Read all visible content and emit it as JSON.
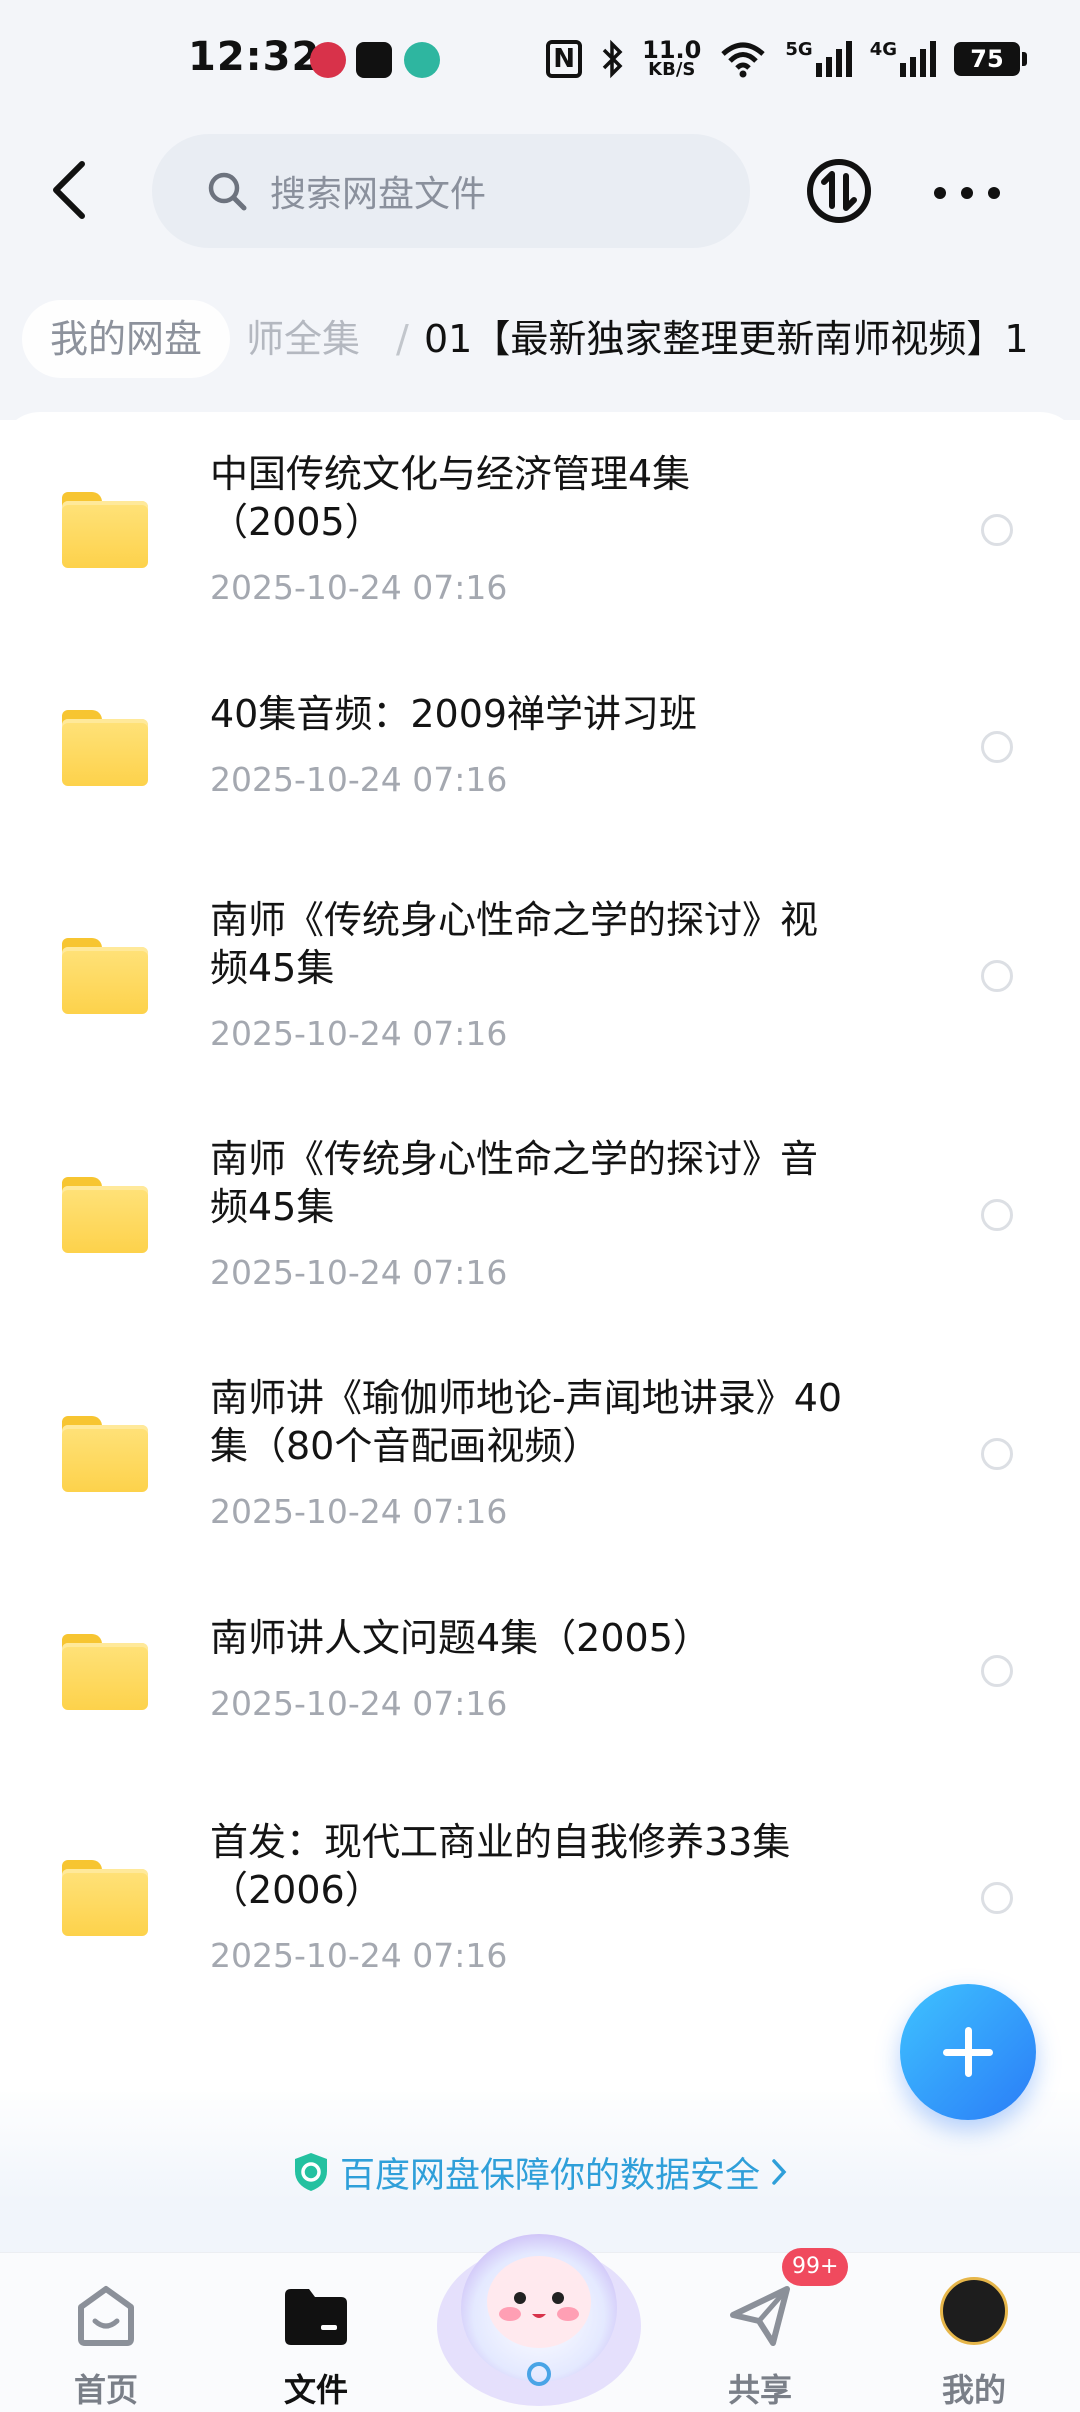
{
  "status_bar": {
    "time": "12:32",
    "speed_value": "11.0",
    "speed_unit": "KB/S",
    "net1": "5G",
    "net2": "4G",
    "battery": "75"
  },
  "header": {
    "search_placeholder": "搜索网盘文件"
  },
  "breadcrumb": {
    "home": "我的网盘",
    "middle": "师全集",
    "separator": "/",
    "current": "01【最新独家整理更新南师视频】1"
  },
  "files": [
    {
      "line1": "中国传统文化与经济管理4集",
      "line2": "（2005）",
      "date": "2025-10-24  07:16"
    },
    {
      "line1": "40集音频：2009禅学讲习班",
      "line2": "",
      "date": "2025-10-24  07:16"
    },
    {
      "line1": "南师《传统身心性命之学的探讨》视",
      "line2": "频45集",
      "date": "2025-10-24  07:16"
    },
    {
      "line1": "南师《传统身心性命之学的探讨》音",
      "line2": "频45集",
      "date": "2025-10-24  07:16"
    },
    {
      "line1": "南师讲《瑜伽师地论-声闻地讲录》40",
      "line2": "集（80个音配画视频）",
      "date": "2025-10-24  07:16"
    },
    {
      "line1": "南师讲人文问题4集（2005）",
      "line2": "",
      "date": "2025-10-24  07:16"
    },
    {
      "line1": "首发：现代工商业的自我修养33集",
      "line2": "（2006）",
      "date": "2025-10-24  07:16"
    }
  ],
  "security_banner": "百度网盘保障你的数据安全",
  "bottom_nav": {
    "home": "首页",
    "files": "文件",
    "share": "共享",
    "share_badge": "99+",
    "mine": "我的"
  },
  "colors": {
    "accent": "#2f9fd9",
    "fab": "#2a7cf7",
    "badge": "#f04a5e",
    "folder": "#fdd24b"
  }
}
